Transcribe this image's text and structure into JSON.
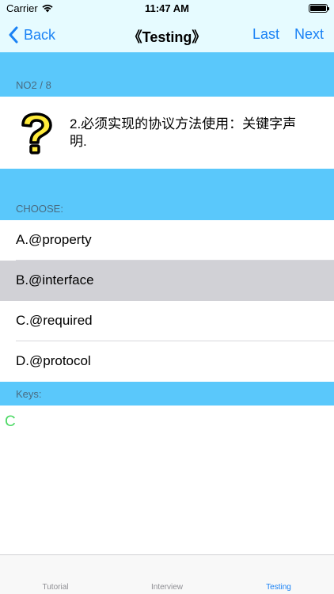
{
  "status_bar": {
    "carrier": "Carrier",
    "time": "11:47 AM"
  },
  "nav": {
    "back_label": "Back",
    "title": "《Testing》",
    "last_label": "Last",
    "next_label": "Next"
  },
  "question": {
    "progress": "NO2 / 8",
    "text": "2.必须实现的协议方法使用：关键字声明."
  },
  "choose": {
    "header": "CHOOSE:",
    "options": [
      {
        "label": "A.@property",
        "selected": false
      },
      {
        "label": "B.@interface",
        "selected": true
      },
      {
        "label": "C.@required",
        "selected": false
      },
      {
        "label": "D.@protocol",
        "selected": false
      }
    ]
  },
  "keys": {
    "header": "Keys:",
    "answer": "C"
  },
  "tabs": [
    {
      "label": "Tutorial",
      "active": false
    },
    {
      "label": "Interview",
      "active": false
    },
    {
      "label": "Testing",
      "active": true
    }
  ],
  "colors": {
    "accent": "#1a82f5",
    "section_blue": "#5ac8fb",
    "answer_green": "#4cd964",
    "selected_row": "#d1d1d6"
  }
}
